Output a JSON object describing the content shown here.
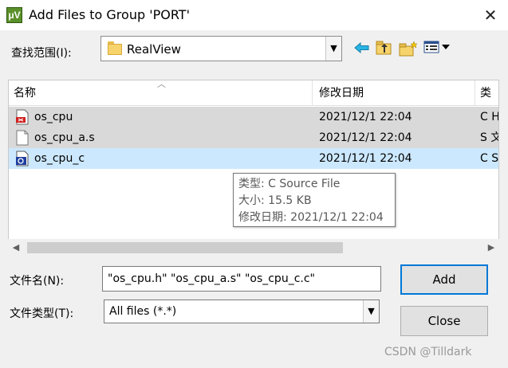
{
  "window": {
    "title": "Add Files to Group 'PORT'",
    "app_icon": "μV",
    "close_symbol": "✕"
  },
  "lookin": {
    "label": "查找范围(I):",
    "value": "RealView"
  },
  "toolbar": {
    "back": "back-arrow",
    "up": "up-folder",
    "new_folder": "new-folder",
    "view_menu": "view-menu"
  },
  "list": {
    "columns": [
      "名称",
      "修改日期",
      "类"
    ],
    "rows": [
      {
        "name": "os_cpu",
        "date": "2021/12/1 22:04",
        "type": "C H",
        "icon": "header-file-icon",
        "state": "selected"
      },
      {
        "name": "os_cpu_a.s",
        "date": "2021/12/1 22:04",
        "type": "S 文",
        "icon": "blank-file-icon",
        "state": "selected"
      },
      {
        "name": "os_cpu_c",
        "date": "2021/12/1 22:04",
        "type": "C S",
        "icon": "c-source-file-icon",
        "state": "focused"
      }
    ]
  },
  "tooltip": {
    "type_line": "类型: C Source File",
    "size_line": "大小: 15.5 KB",
    "date_line": "修改日期: 2021/12/1 22:04"
  },
  "filename": {
    "label": "文件名(N):",
    "value": "\"os_cpu.h\" \"os_cpu_a.s\" \"os_cpu_c.c\""
  },
  "filetype": {
    "label": "文件类型(T):",
    "value": "All files (*.*)"
  },
  "buttons": {
    "add": "Add",
    "close": "Close"
  },
  "watermark": "CSDN @Tilldark",
  "colors": {
    "selected_row": "#d9d9d9",
    "focused_row": "#cce8ff",
    "default_button_border": "#0078d7"
  }
}
